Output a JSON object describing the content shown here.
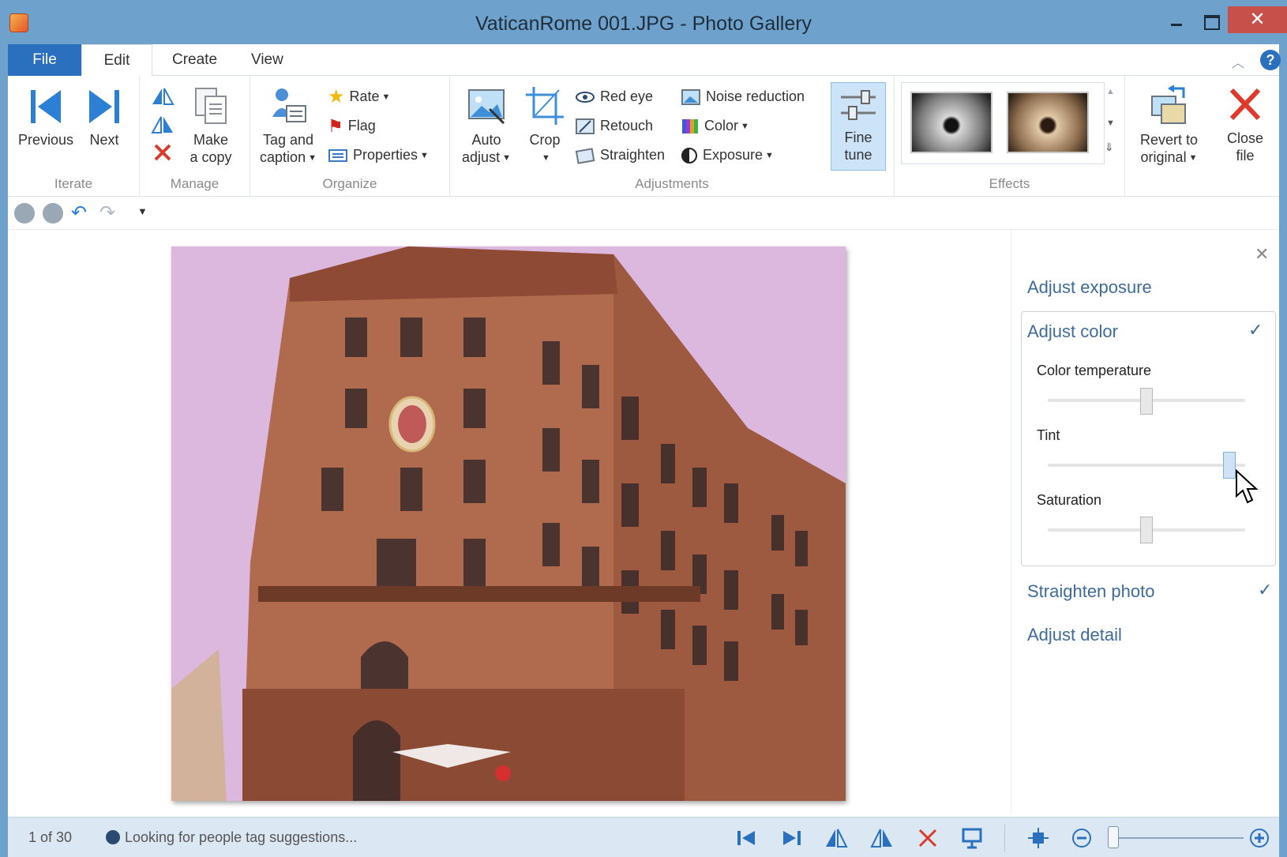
{
  "window": {
    "title": "VaticanRome 001.JPG - Photo Gallery",
    "close_glyph": "✕"
  },
  "tabs": [
    "File",
    "Edit",
    "Create",
    "View"
  ],
  "ribbon": {
    "iterate": {
      "label": "Iterate",
      "previous": "Previous",
      "next": "Next"
    },
    "manage": {
      "label": "Manage",
      "make_copy_line1": "Make",
      "make_copy_line2": "a copy"
    },
    "organize": {
      "label": "Organize",
      "tag_line1": "Tag and",
      "tag_line2": "caption",
      "rate": "Rate",
      "flag": "Flag",
      "properties": "Properties"
    },
    "adjustments": {
      "label": "Adjustments",
      "auto_line1": "Auto",
      "auto_line2": "adjust",
      "crop": "Crop",
      "red_eye": "Red eye",
      "retouch": "Retouch",
      "straighten": "Straighten",
      "noise_reduction": "Noise reduction",
      "color": "Color",
      "exposure": "Exposure",
      "fine_line1": "Fine",
      "fine_line2": "tune"
    },
    "effects": {
      "label": "Effects"
    },
    "revert": {
      "line1": "Revert to",
      "line2": "original"
    },
    "close": {
      "line1": "Close",
      "line2": "file"
    }
  },
  "fine_tune": {
    "adjust_exposure": "Adjust exposure",
    "adjust_color": "Adjust color",
    "color_temperature": "Color temperature",
    "tint": "Tint",
    "saturation": "Saturation",
    "straighten_photo": "Straighten photo",
    "adjust_detail": "Adjust detail",
    "close_glyph": "✕",
    "check_glyph": "✓",
    "color_temperature_level": 0.5,
    "tint_level": 0.95,
    "saturation_level": 0.5
  },
  "status": {
    "count": "1 of 30",
    "message": "Looking for people tag suggestions...",
    "zoom_level": 0
  },
  "colors": {
    "accent": "#2b6fbf",
    "titlebar": "#6ea2cd",
    "close": "#c7504a",
    "pane_text": "#3e6a9c"
  }
}
